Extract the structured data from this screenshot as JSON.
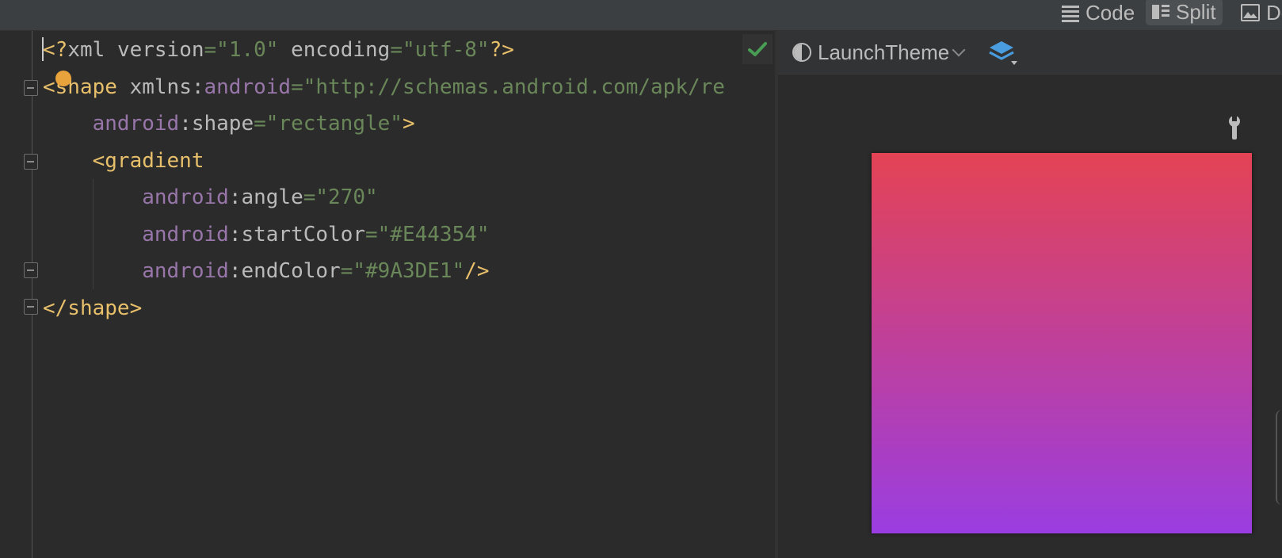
{
  "toolbar": {
    "views": [
      {
        "label": "Code",
        "icon": "list-lines-icon"
      },
      {
        "label": "Split",
        "icon": "split-view-icon",
        "active": true
      },
      {
        "label": "De",
        "icon": "image-icon"
      }
    ]
  },
  "editor": {
    "lines": [
      {
        "parts": [
          [
            "tag",
            "<?"
          ],
          [
            "attr",
            "xml "
          ],
          [
            "attr",
            "version"
          ],
          [
            "eq",
            "="
          ],
          [
            "val",
            "\"1.0\""
          ],
          [
            "attr",
            " encoding"
          ],
          [
            "eq",
            "="
          ],
          [
            "val",
            "\"utf-8\""
          ],
          [
            "tag",
            "?>"
          ]
        ]
      },
      {
        "parts": [
          [
            "tag",
            "<shape "
          ],
          [
            "attr",
            "xmlns:"
          ],
          [
            "ns",
            "android"
          ],
          [
            "eq",
            "="
          ],
          [
            "val",
            "\"http://schemas.android.com/apk/re"
          ]
        ]
      },
      {
        "parts": [
          [
            "ns",
            "    android"
          ],
          [
            "attr",
            ":shape"
          ],
          [
            "eq",
            "="
          ],
          [
            "val",
            "\"rectangle\""
          ],
          [
            "tag",
            ">"
          ]
        ]
      },
      {
        "parts": [
          [
            "tag",
            "    <gradient"
          ]
        ]
      },
      {
        "parts": [
          [
            "ns",
            "        android"
          ],
          [
            "attr",
            ":angle"
          ],
          [
            "eq",
            "="
          ],
          [
            "val",
            "\"270\""
          ]
        ]
      },
      {
        "parts": [
          [
            "ns",
            "        android"
          ],
          [
            "attr",
            ":startColor"
          ],
          [
            "eq",
            "="
          ],
          [
            "val",
            "\"#E44354\""
          ]
        ]
      },
      {
        "parts": [
          [
            "ns",
            "        android"
          ],
          [
            "attr",
            ":endColor"
          ],
          [
            "eq",
            "="
          ],
          [
            "val",
            "\"#9A3DE1\""
          ],
          [
            "tag",
            "/>"
          ]
        ]
      },
      {
        "parts": [
          [
            "tag",
            "</shape>"
          ]
        ]
      }
    ],
    "status_icon": "check-icon"
  },
  "preview": {
    "theme": "LaunchTheme",
    "theme_icon": "theme-contrast-icon",
    "layers_icon": "layers-icon",
    "wrench_icon": "wrench-icon",
    "gradient": {
      "start_color": "#E44354",
      "end_color": "#9A3DE1",
      "angle": 270
    }
  },
  "colors": {
    "tag": "#e8bf6a",
    "attr": "#bababa",
    "namespace": "#9876aa",
    "value": "#6a8759",
    "check": "#499c54",
    "layers": "#4a9ee0"
  }
}
